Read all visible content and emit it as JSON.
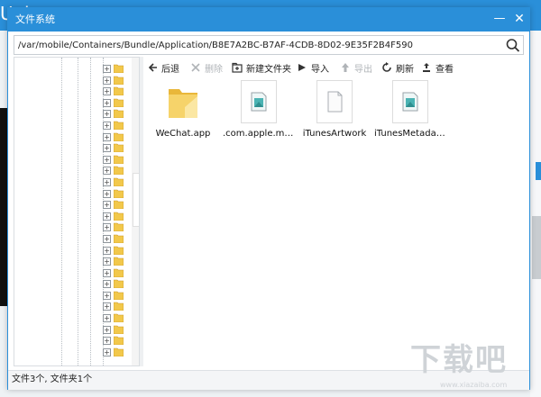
{
  "background": {
    "logo_text": "Uels"
  },
  "dialog": {
    "title": "文件系统",
    "minimize_glyph": "—",
    "close_glyph": "✕"
  },
  "path": {
    "value": "/var/mobile/Containers/Bundle/Application/B8E7A2BC-B7AF-4CDB-8D02-9E35F2B4F590"
  },
  "toolbar": {
    "back_label": "后退",
    "delete_label": "删除",
    "new_folder_label": "新建文件夹",
    "import_label": "导入",
    "export_label": "导出",
    "refresh_label": "刷新",
    "view_label": "查看"
  },
  "tree": {
    "row_count": 26,
    "plus_glyph": "+"
  },
  "files": [
    {
      "name": "WeChat.app",
      "type": "folder"
    },
    {
      "name": ".com.apple.mobil...",
      "type": "document-image"
    },
    {
      "name": "iTunesArtwork",
      "type": "document-blank"
    },
    {
      "name": "iTunesMetadata....",
      "type": "document-image"
    }
  ],
  "status": {
    "text": "文件3个, 文件夹1个"
  },
  "watermark": {
    "text": "下载吧",
    "sub": "www.xiazaiba.com"
  },
  "colors": {
    "accent": "#2a8fd9",
    "folder": "#f2c84b"
  },
  "icons": {
    "back": "back-arrow-icon",
    "delete": "delete-x-icon",
    "new_folder": "new-folder-icon",
    "import": "import-arrow-icon",
    "export": "export-arrow-icon",
    "refresh": "refresh-icon",
    "view": "view-icon",
    "search": "search-icon"
  }
}
